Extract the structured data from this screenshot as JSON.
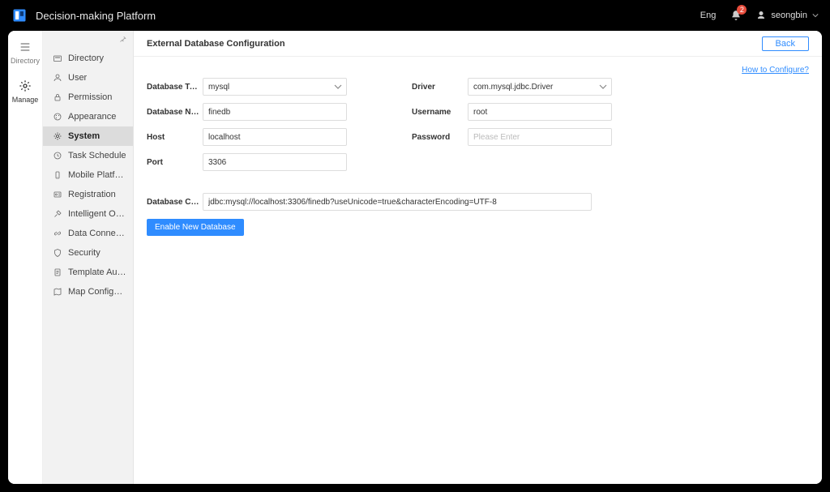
{
  "header": {
    "app_title": "Decision-making Platform",
    "language": "Eng",
    "notification_count": "2",
    "username": "seongbin"
  },
  "rail": {
    "directory": "Directory",
    "manage": "Manage"
  },
  "sidebar": {
    "items": [
      {
        "label": "Directory",
        "icon": "folder-icon"
      },
      {
        "label": "User",
        "icon": "user-icon"
      },
      {
        "label": "Permission",
        "icon": "lock-icon"
      },
      {
        "label": "Appearance",
        "icon": "palette-icon"
      },
      {
        "label": "System",
        "icon": "gear-icon"
      },
      {
        "label": "Task Schedule",
        "icon": "clock-icon"
      },
      {
        "label": "Mobile Platform",
        "icon": "mobile-icon"
      },
      {
        "label": "Registration",
        "icon": "id-icon"
      },
      {
        "label": "Intelligent Operatio...",
        "icon": "tools-icon"
      },
      {
        "label": "Data Connection",
        "icon": "link-icon"
      },
      {
        "label": "Security",
        "icon": "shield-icon"
      },
      {
        "label": "Template Authenti...",
        "icon": "doc-icon"
      },
      {
        "label": "Map Configuration",
        "icon": "map-icon"
      }
    ]
  },
  "page": {
    "title": "External Database Configuration",
    "back_label": "Back",
    "help_label": "How to Configure?",
    "labels": {
      "db_type": "Database Type",
      "db_name": "Database Name",
      "host": "Host",
      "port": "Port",
      "driver": "Driver",
      "username": "Username",
      "password": "Password",
      "conn_url": "Database Connec...",
      "password_placeholder": "Please Enter"
    },
    "values": {
      "db_type": "mysql",
      "db_name": "finedb",
      "host": "localhost",
      "port": "3306",
      "driver": "com.mysql.jdbc.Driver",
      "username": "root",
      "password": "",
      "conn_url": "jdbc:mysql://localhost:3306/finedb?useUnicode=true&characterEncoding=UTF-8"
    },
    "enable_button": "Enable New Database"
  }
}
